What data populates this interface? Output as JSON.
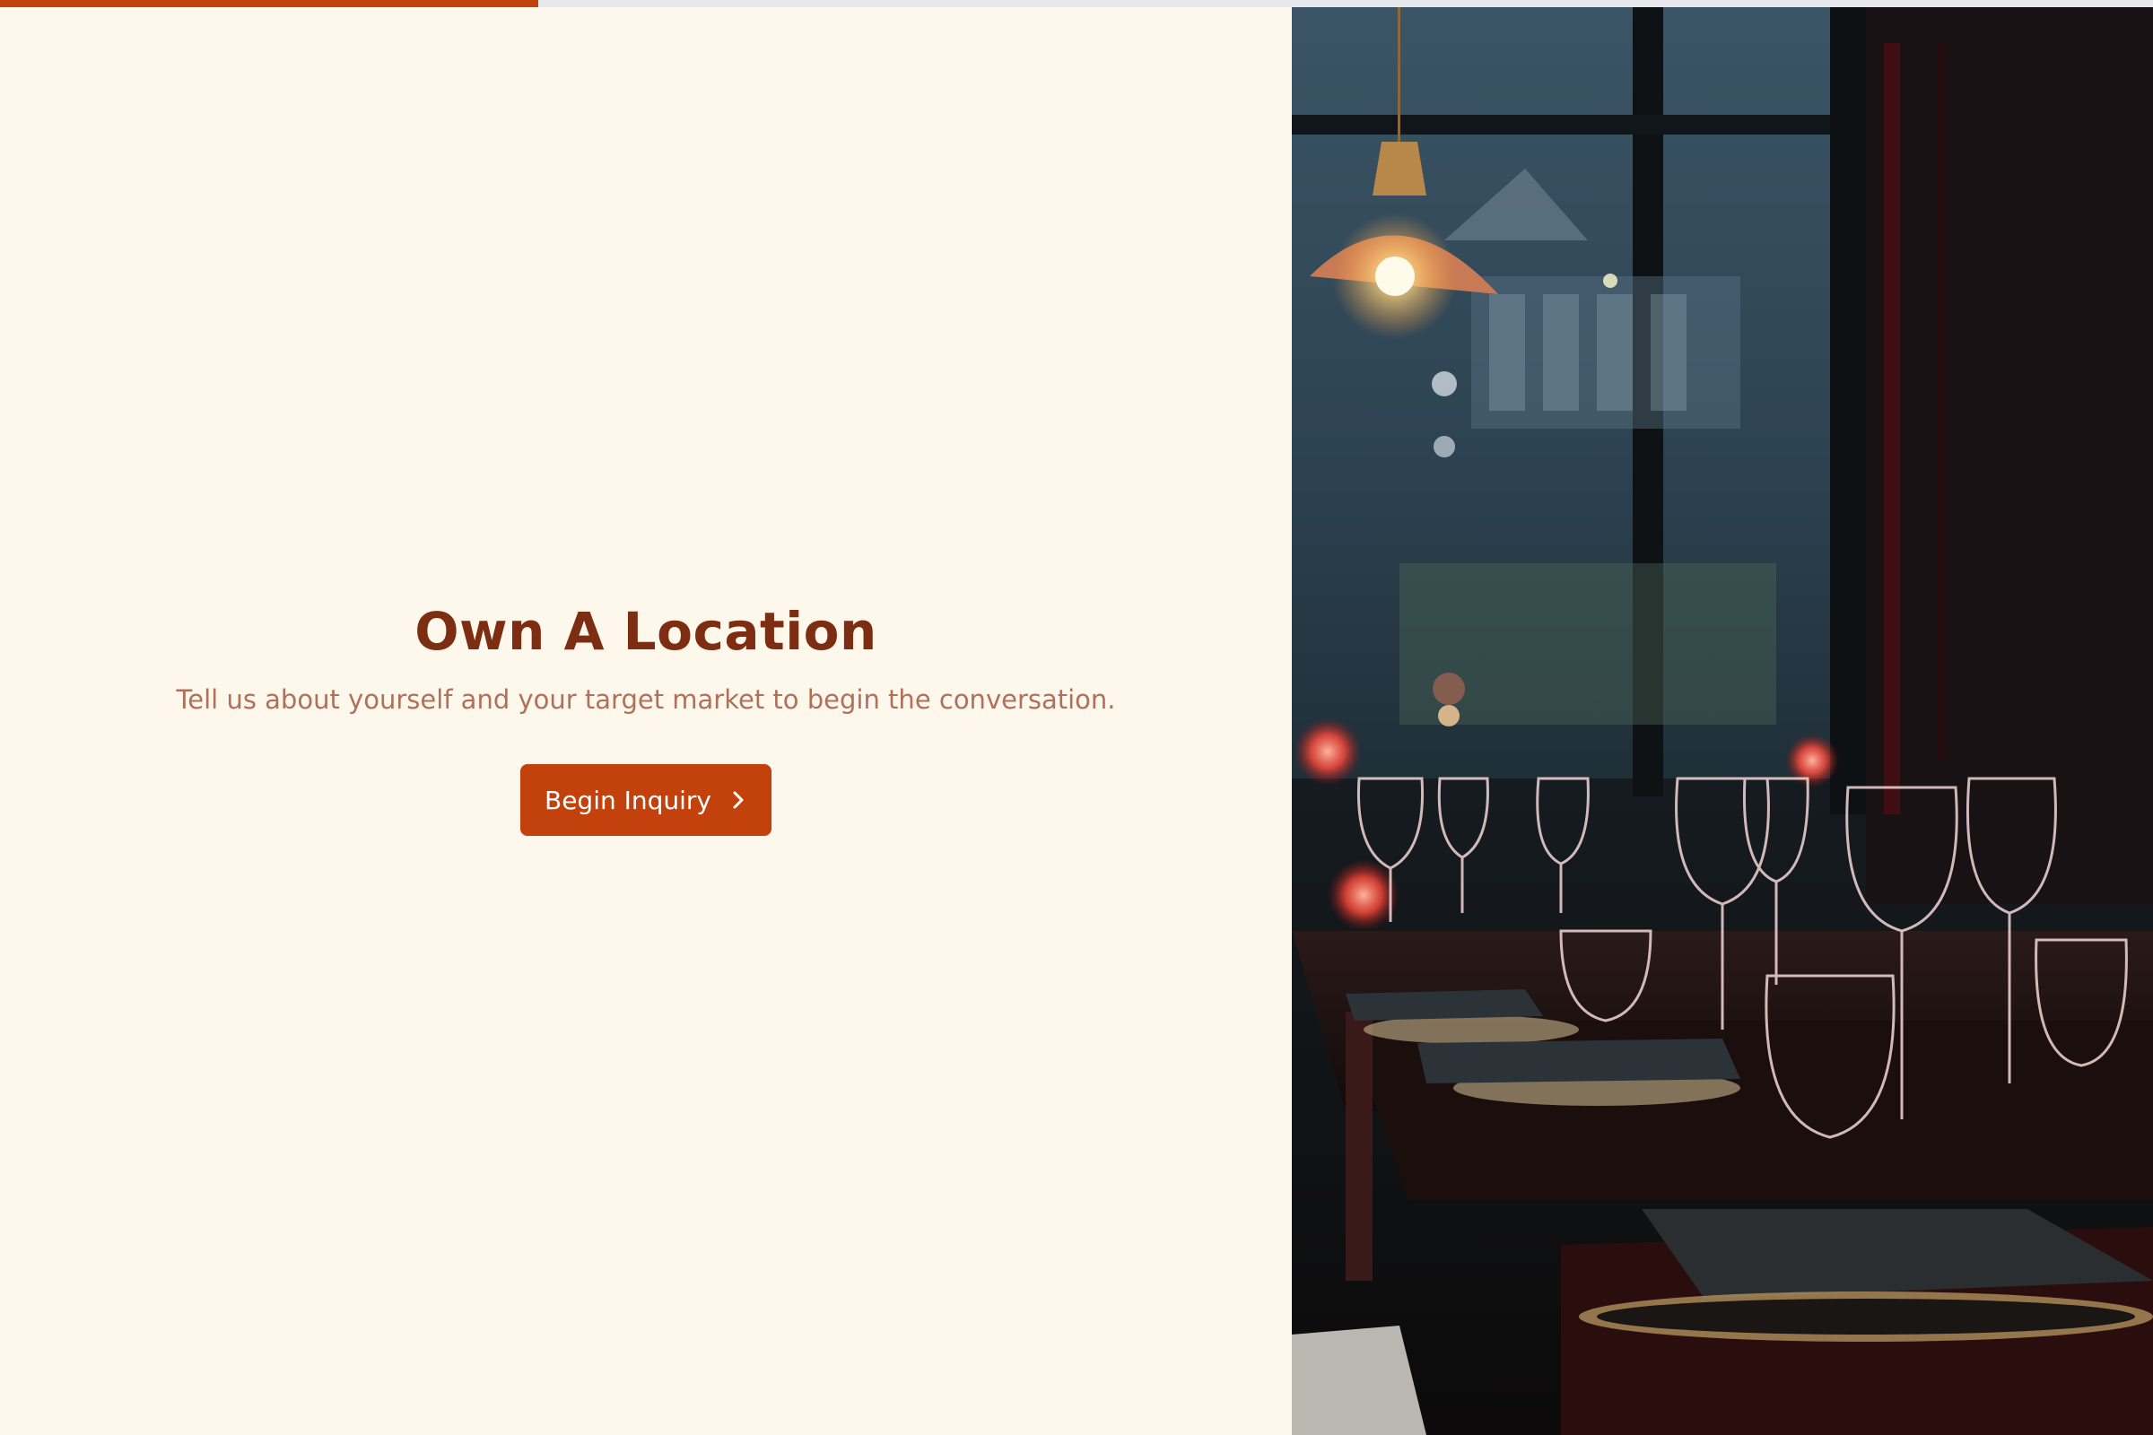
{
  "progress": {
    "percent": 25
  },
  "hero": {
    "title": "Own A Location",
    "subtitle": "Tell us about yourself and your target market to begin the conversation.",
    "cta_label": "Begin Inquiry",
    "cta_icon": "chevron-right-icon"
  },
  "photo": {
    "subject": "restaurant-interior-photo"
  },
  "colors": {
    "accent": "#c2410c",
    "heading": "#7c2d12",
    "subtext": "#b0705a",
    "background": "#fdf7ec"
  }
}
